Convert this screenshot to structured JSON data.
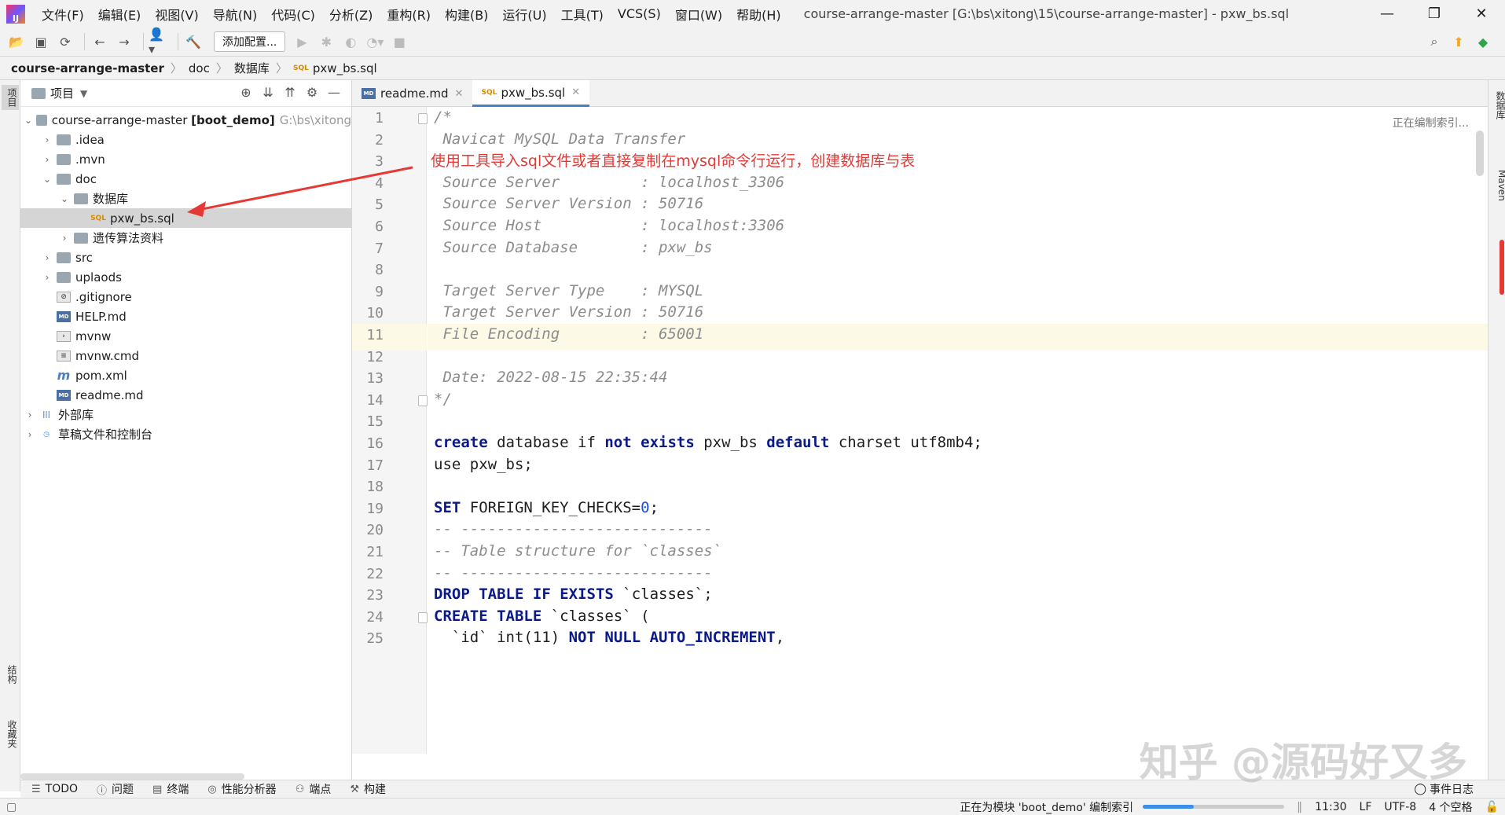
{
  "menubar": {
    "app_logo": "IJ",
    "items": [
      "文件(F)",
      "编辑(E)",
      "视图(V)",
      "导航(N)",
      "代码(C)",
      "分析(Z)",
      "重构(R)",
      "构建(B)",
      "运行(U)",
      "工具(T)",
      "VCS(S)",
      "窗口(W)",
      "帮助(H)"
    ],
    "window_title": "course-arrange-master [G:\\bs\\xitong\\15\\course-arrange-master] - pxw_bs.sql",
    "controls": {
      "minimize": "—",
      "restore": "❐",
      "close": "✕"
    }
  },
  "toolbar": {
    "add_config_label": "添加配置..."
  },
  "breadcrumb": [
    "course-arrange-master",
    "doc",
    "数据库",
    "pxw_bs.sql"
  ],
  "left_strip": {
    "project_tab": "项目",
    "structure_tab": "结构",
    "favorites_tab": "收藏夹"
  },
  "right_strip": {
    "database_tab": "数据库",
    "maven_tab": "Maven"
  },
  "project_panel": {
    "title": "项目",
    "tree": [
      {
        "label": "course-arrange-master",
        "bold": "[boot_demo]",
        "path": "G:\\bs\\xitong"
      },
      {
        "label": ".idea"
      },
      {
        "label": ".mvn"
      },
      {
        "label": "doc"
      },
      {
        "label": "数据库"
      },
      {
        "label": "pxw_bs.sql"
      },
      {
        "label": "遗传算法资料"
      },
      {
        "label": "src"
      },
      {
        "label": "uplaods"
      },
      {
        "label": ".gitignore"
      },
      {
        "label": "HELP.md"
      },
      {
        "label": "mvnw"
      },
      {
        "label": "mvnw.cmd"
      },
      {
        "label": "pom.xml"
      },
      {
        "label": "readme.md"
      },
      {
        "label": "外部库"
      },
      {
        "label": "草稿文件和控制台"
      }
    ]
  },
  "tabs": [
    {
      "label": "readme.md"
    },
    {
      "label": "pxw_bs.sql"
    }
  ],
  "editor": {
    "indexing_hint": "正在编制索引...",
    "annotation": "使用工具导入sql文件或者直接复制在mysql命令行运行，创建数据库与表",
    "line_numbers": [
      "1",
      "2",
      "3",
      "4",
      "5",
      "6",
      "7",
      "8",
      "9",
      "10",
      "11",
      "12",
      "13",
      "14",
      "15",
      "16",
      "17",
      "18",
      "19",
      "20",
      "21",
      "22",
      "23",
      "24",
      "25"
    ],
    "lines": [
      "/*",
      " Navicat MySQL Data Transfer",
      "",
      " Source Server         : localhost_3306",
      " Source Server Version : 50716",
      " Source Host           : localhost:3306",
      " Source Database       : pxw_bs",
      "",
      " Target Server Type    : MYSQL",
      " Target Server Version : 50716",
      " File Encoding         : 65001",
      "",
      " Date: 2022-08-15 22:35:44",
      "*/",
      "",
      "create database if not exists pxw_bs default charset utf8mb4;",
      "use pxw_bs;",
      "",
      "SET FOREIGN_KEY_CHECKS=0;",
      "-- ----------------------------",
      "-- Table structure for `classes`",
      "-- ----------------------------",
      "DROP TABLE IF EXISTS `classes`;",
      "CREATE TABLE `classes` (",
      "  `id` int(11) NOT NULL AUTO_INCREMENT,"
    ],
    "current_line": "11"
  },
  "toolwindows": [
    "TODO",
    "问题",
    "终端",
    "性能分析器",
    "端点",
    "构建"
  ],
  "event_log": "事件日志",
  "status": {
    "indexing_text": "正在为模块 'boot_demo' 编制索引",
    "progress": 0.36,
    "position": "11:30",
    "line_sep": "LF",
    "encoding": "UTF-8",
    "indent": "4 个空格"
  },
  "watermark": "知乎 @源码好又多",
  "colors": {
    "accent": "#4083c9",
    "annotation": "#e53935",
    "keyword": "#0b1a8a",
    "comment": "#8c8c8c"
  }
}
